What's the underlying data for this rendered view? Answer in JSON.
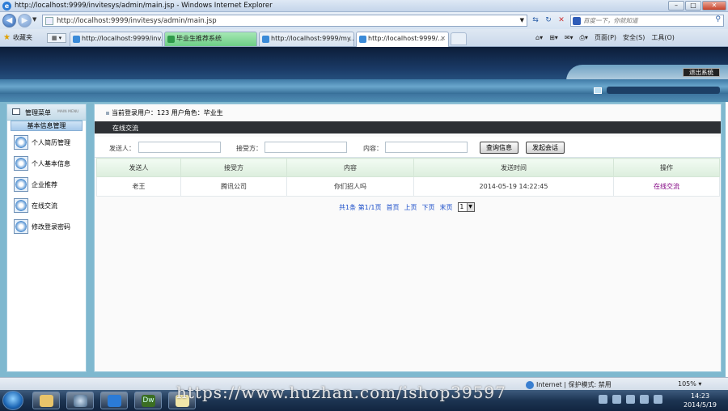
{
  "browser": {
    "window_title": "http://localhost:9999/invitesys/admin/main.jsp - Windows Internet Explorer",
    "address": "http://localhost:9999/invitesys/admin/main.jsp",
    "search_placeholder": "百度一下，你就知道",
    "favorites_label": "收藏夹",
    "tabs": [
      {
        "label": "http://localhost:9999/inv...",
        "state": "normal"
      },
      {
        "label": "毕业生推荐系统",
        "state": "green"
      },
      {
        "label": "http://localhost:9999/my...",
        "state": "normal"
      },
      {
        "label": "http://localhost:9999/...",
        "state": "active"
      }
    ],
    "commands": {
      "page": "页面(P)",
      "safety": "安全(S)",
      "tools": "工具(O)"
    },
    "status": {
      "zone": "Internet | 保护模式: 禁用",
      "zoom": "105%"
    }
  },
  "app": {
    "logout_label": "退出系统",
    "sidebar": {
      "title": "管理菜单",
      "title_en": "MAIN MENU",
      "section": "基本信息管理",
      "items": [
        "个人简历管理",
        "个人基本信息",
        "企业推荐",
        "在线交流",
        "修改登录密码"
      ]
    },
    "user_line": "当前登录用户：123  用户角色：毕业生",
    "section_title": "在线交流",
    "search": {
      "sender_label": "发送人：",
      "receiver_label": "接受方：",
      "content_label": "内容：",
      "query_button": "查询信息",
      "start_chat_button": "发起会话"
    },
    "table": {
      "headers": [
        "发送人",
        "接受方",
        "内容",
        "发送时间",
        "操作"
      ],
      "rows": [
        [
          "老王",
          "腾讯公司",
          "你们招人吗",
          "2014-05-19 14:22:45",
          "在线交流"
        ]
      ]
    },
    "pager": {
      "summary": "共1条 第1/1页",
      "first": "首页",
      "prev": "上页",
      "next": "下页",
      "last": "末页",
      "page": "1"
    }
  },
  "taskbar": {
    "time": "14:23",
    "date": "2014/5/19"
  },
  "watermark": "https://www.huzhan.com/ishop39597"
}
